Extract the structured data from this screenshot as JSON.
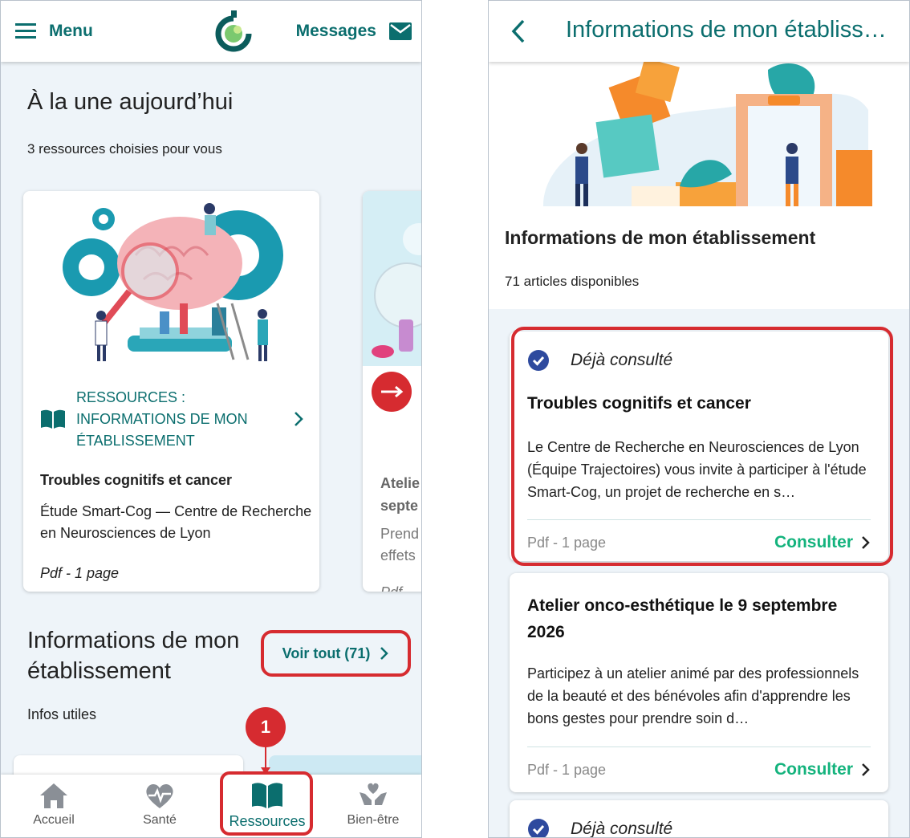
{
  "left": {
    "header": {
      "menu_label": "Menu",
      "messages_label": "Messages"
    },
    "featured": {
      "title": "À la une aujourd’hui",
      "subtitle": "3 ressources choisies pour vous",
      "card1": {
        "category": "RESSOURCES : INFORMATIONS DE MON ÉTABLISSEMENT",
        "title": "Troubles cognitifs et cancer",
        "description": "Étude Smart-Cog — Centre de Recherche en Neurosciences de Lyon",
        "meta": "Pdf - 1 page"
      },
      "card2": {
        "title": "Atelie septe",
        "description": "Prend effets",
        "meta": "Pdf"
      }
    },
    "section": {
      "title": "Informations de mon établissement",
      "see_all": "Voir tout (71)",
      "subtitle": "Infos utiles"
    },
    "callout": "1",
    "tabs": [
      {
        "label": "Accueil",
        "icon": "home-icon"
      },
      {
        "label": "Santé",
        "icon": "heart-pulse-icon"
      },
      {
        "label": "Ressources",
        "icon": "book-icon"
      },
      {
        "label": "Bien-être",
        "icon": "care-hands-icon"
      }
    ],
    "active_tab": "Ressources"
  },
  "right": {
    "header": {
      "title": "Informations de mon établissement"
    },
    "title": "Informations de mon établissement",
    "subtitle": "71 articles disponibles",
    "articles": [
      {
        "status": "Déjà consulté",
        "title": "Troubles cognitifs et cancer",
        "description": "Le Centre de Recherche en Neurosciences de Lyon (Équipe Trajectoires) vous invite à participer à l'étude Smart-Cog, un projet de recherche en s…",
        "meta": "Pdf - 1 page",
        "action": "Consulter"
      },
      {
        "title": "Atelier onco-esthétique le 9 septembre 2026",
        "description": "Participez à un atelier animé par des professionnels de la beauté et des bénévoles afin d'apprendre les bons gestes pour prendre soin d…",
        "meta": "Pdf - 1 page",
        "action": "Consulter"
      },
      {
        "status": "Déjà consulté"
      }
    ]
  },
  "colors": {
    "teal": "#0b6e6e",
    "green_link": "#14b37d",
    "highlight_red": "#d62b30",
    "background": "#eef4f9"
  }
}
